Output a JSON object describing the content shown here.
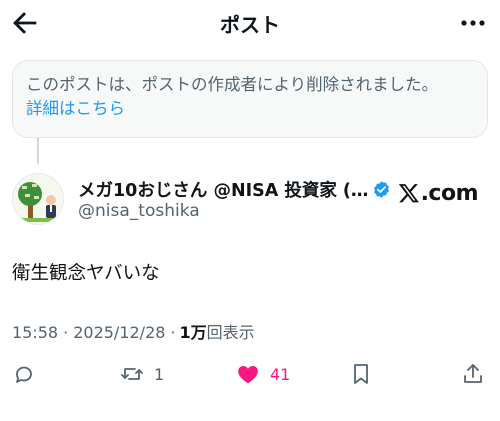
{
  "header": {
    "title": "ポスト"
  },
  "deleted_notice": {
    "message": "このポストは、ポストの作成者により削除されました。",
    "link": "詳細はこちら"
  },
  "author": {
    "display_name": "メガ10おじさん @NISA 投資家 (…",
    "handle": "@nisa_toshika",
    "source": ".com"
  },
  "post": {
    "text": "衛生観念ヤバいな",
    "time": "15:58",
    "separator": "·",
    "date": "2025/12/28",
    "views_count": "1万",
    "views_label": "回表示"
  },
  "actions": {
    "reply_count": "",
    "repost_count": "1",
    "like_count": "41"
  },
  "colors": {
    "link": "#1d9bf0",
    "like": "#f91880",
    "verified": "#1d9bf0",
    "muted": "#536471"
  }
}
